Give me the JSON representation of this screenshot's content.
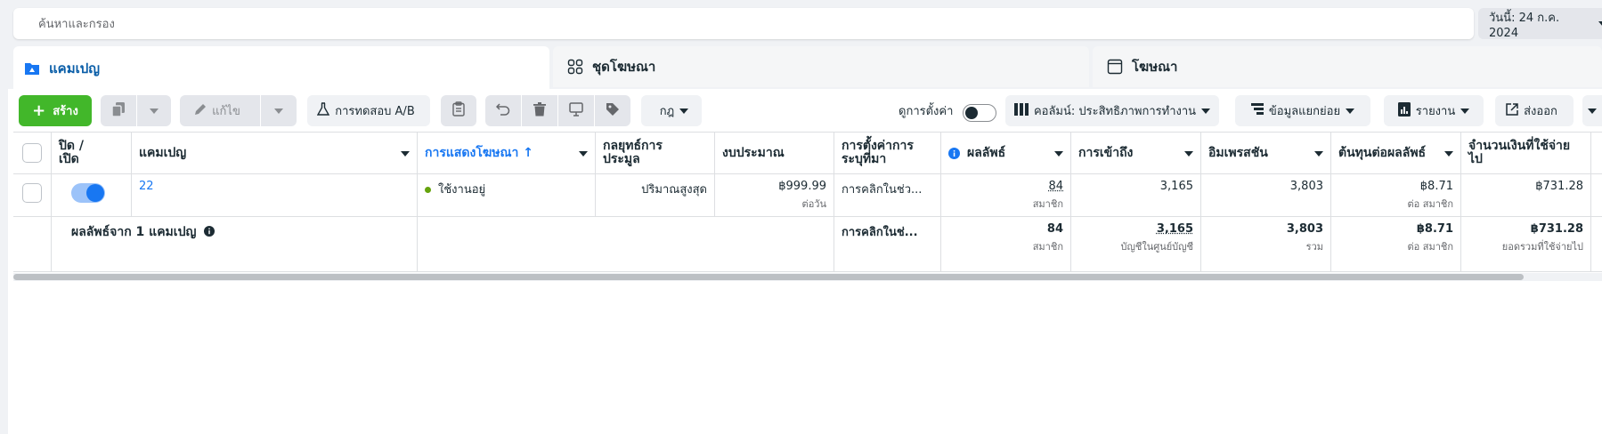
{
  "search": {
    "placeholder": "ค้นหาและกรอง"
  },
  "date": {
    "label": "วันนี้: 24 ก.ค. 2024"
  },
  "tabs": [
    {
      "label": "แคมเปญ",
      "icon": "folder-icon"
    },
    {
      "label": "ชุดโฆษณา",
      "icon": "grid-icon"
    },
    {
      "label": "โฆษณา",
      "icon": "ad-icon"
    }
  ],
  "toolbar": {
    "create": "สร้าง",
    "edit": "แก้ไข",
    "ab_test": "การทดสอบ A/B",
    "rules": "กฎ",
    "view_settings": "ดูการตั้งค่า",
    "columns": "คอลัมน์: ประสิทธิภาพการทำงาน",
    "breakdown": "ข้อมูลแยกย่อย",
    "reports": "รายงาน",
    "export": "ส่งออก"
  },
  "table": {
    "headers": {
      "onoff": "ปิด / เปิด",
      "campaign": "แคมเปญ",
      "delivery": "การแสดงโฆษณา ↑",
      "bid_strategy": "กลยุทธ์การประมูล",
      "budget": "งบประมาณ",
      "attribution": "การตั้งค่าการระบุที่มา",
      "results": "ผลลัพธ์",
      "reach": "การเข้าถึง",
      "impressions": "อิมเพรสชัน",
      "cost_per_result": "ต้นทุนต่อผลลัพธ์",
      "amount_spent": "จำนวนเงินที่ใช้จ่ายไป"
    },
    "row": {
      "campaign": "22",
      "delivery": "ใช้งานอยู่",
      "bid_strategy": "ปริมาณสูงสุด",
      "budget": "฿999.99",
      "budget_sub": "ต่อวัน",
      "attribution": "การคลิกในช่ว...",
      "results": "84",
      "results_sub": "สมาชิก",
      "reach": "3,165",
      "impressions": "3,803",
      "cost_per_result": "฿8.71",
      "cost_per_result_sub": "ต่อ สมาชิก",
      "amount_spent": "฿731.28"
    },
    "summary": {
      "label": "ผลลัพธ์จาก 1 แคมเปญ",
      "attribution": "การคลิกในช่...",
      "results": "84",
      "results_sub": "สมาชิก",
      "reach": "3,165",
      "reach_sub": "บัญชีในศูนย์บัญชี",
      "impressions": "3,803",
      "impressions_sub": "รวม",
      "cost_per_result": "฿8.71",
      "cost_per_result_sub": "ต่อ สมาชิก",
      "amount_spent": "฿731.28",
      "amount_spent_sub": "ยอดรวมที่ใช้จ่ายไป"
    }
  },
  "colors": {
    "accent": "#1877f2",
    "create": "#42b72a",
    "active_tab_text": "#0a5ea8",
    "status_active": "#65a30d"
  }
}
